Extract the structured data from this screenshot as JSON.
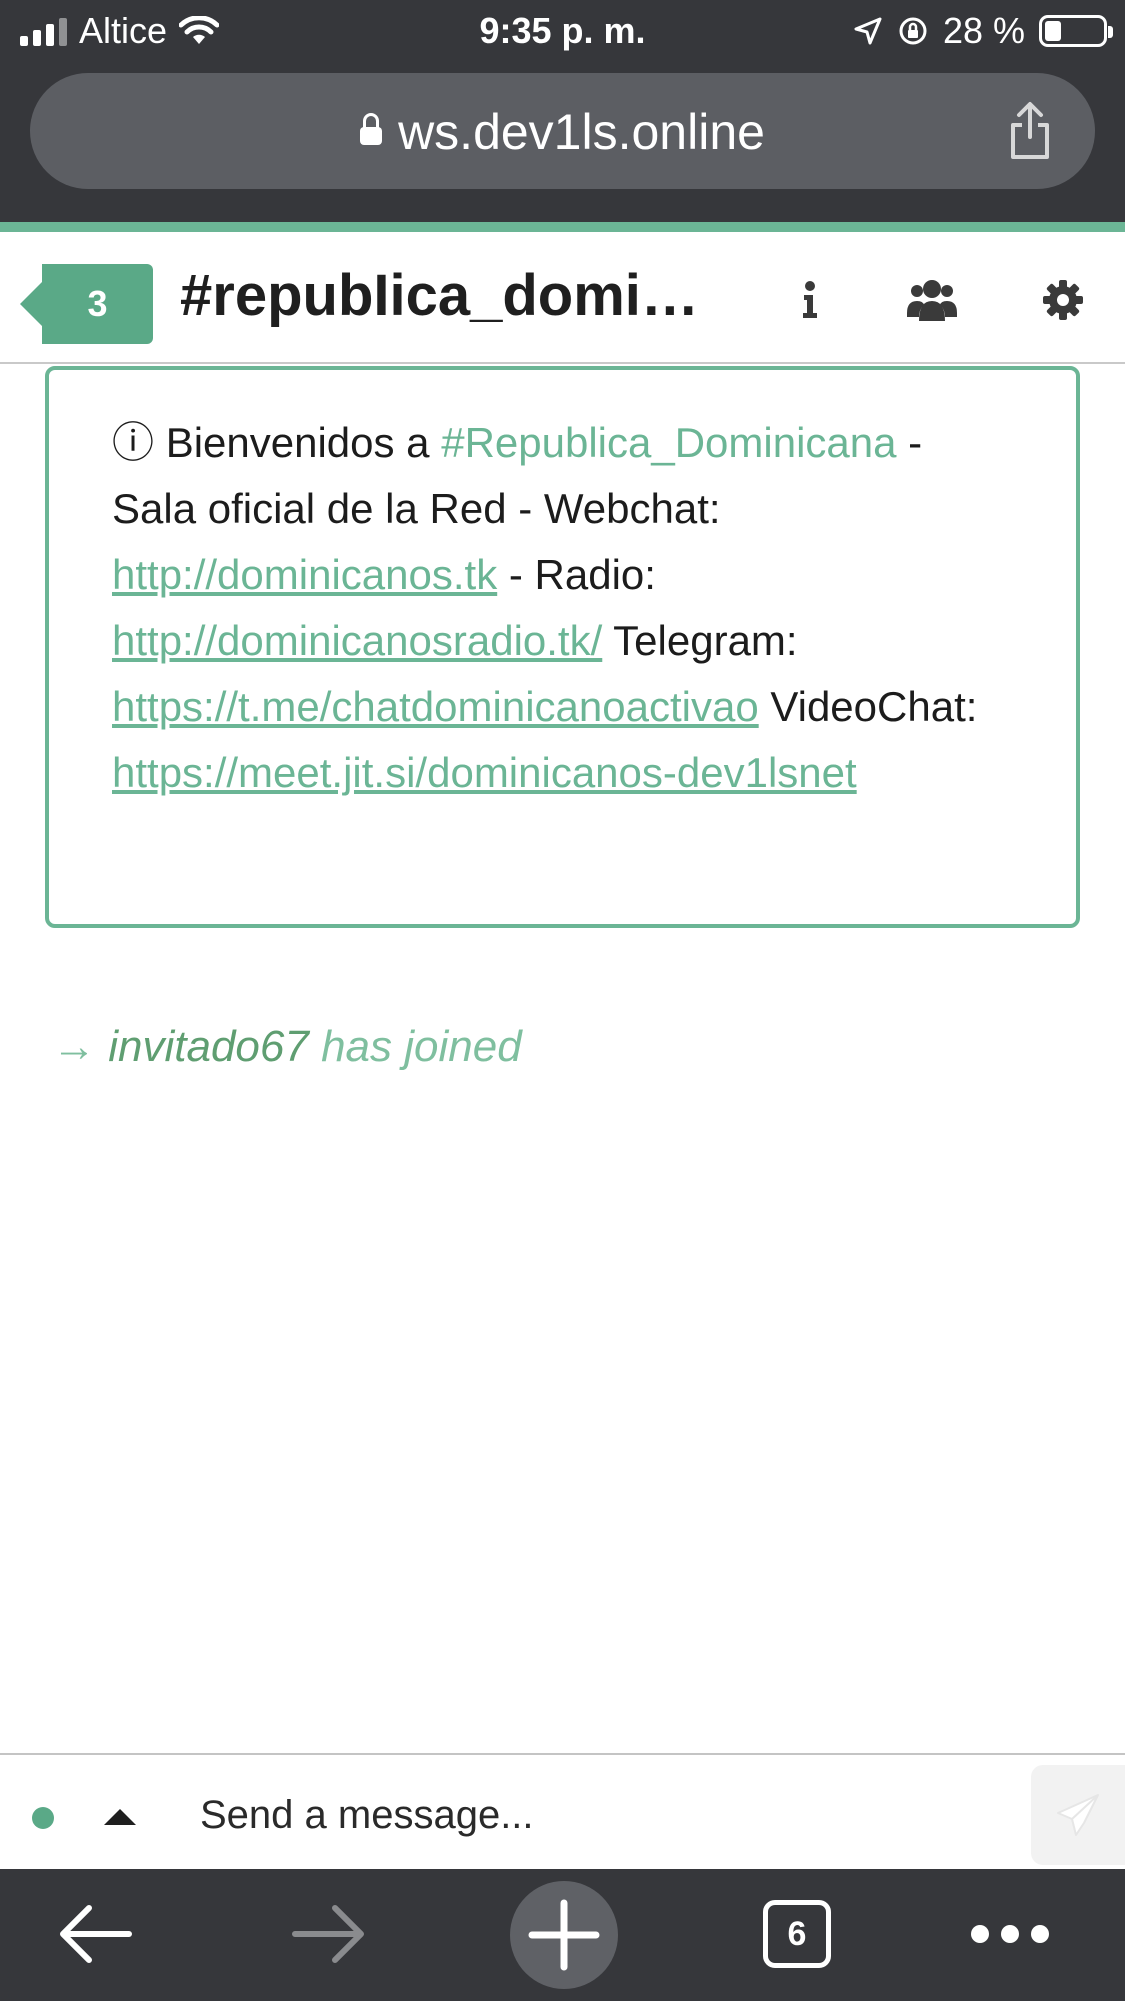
{
  "status_bar": {
    "carrier": "Altice",
    "time": "9:35 p. m.",
    "battery_percent": "28 %"
  },
  "browser": {
    "url": "ws.dev1ls.online"
  },
  "header": {
    "unread_badge": "3",
    "channel_title": "#repubIica_dominicana"
  },
  "topic": {
    "info_glyph": "ⓘ",
    "part1": "Bienvenidos a ",
    "channel": "#Republica_Dominicana",
    "part2": " - Sala oficial de la Red - Webchat: ",
    "link_webchat": "http://dominicanos.tk",
    "part3": " - Radio: ",
    "link_radio": "http://dominicanosradio.tk/",
    "part4": " Telegram: ",
    "link_telegram": "https://t.me/chatdominicanoactivao",
    "part5": " VideoChat: ",
    "link_video": "https://meet.jit.si/dominicanos-dev1lsnet"
  },
  "messages": {
    "join_arrow": "→",
    "join_nick": "invitado67",
    "join_text": "has joined"
  },
  "input": {
    "placeholder": "Send a message..."
  },
  "toolbar": {
    "tabs_count": "6"
  },
  "colors": {
    "accent": "#6bb595",
    "badge": "#5aa987",
    "chrome": "#36373b"
  }
}
